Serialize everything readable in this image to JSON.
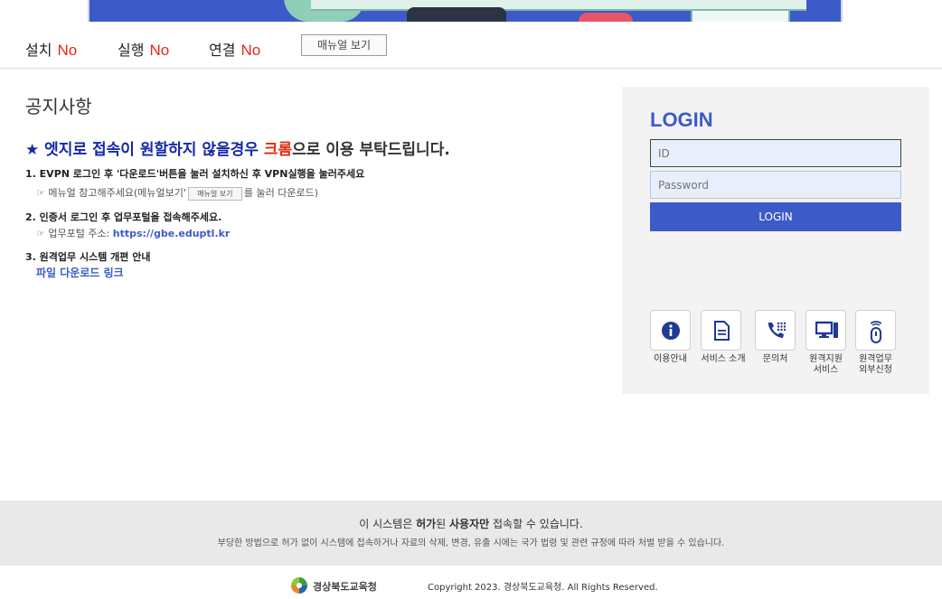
{
  "status": {
    "items": [
      {
        "label": "설치",
        "value": "No"
      },
      {
        "label": "실행",
        "value": "No"
      },
      {
        "label": "연결",
        "value": "No"
      }
    ],
    "manual_button": "매뉴얼 보기"
  },
  "notice": {
    "title": "공지사항",
    "headline": {
      "star": "★",
      "part1": "엣지로 접속이 원할하지 않을경우",
      "part2": "크롬",
      "part3": "으로 이용 부탁드립니다."
    },
    "step1": "1. EVPN 로그인 후 '다운로드'버튼을 눌러 설치하신 후 VPN실행을 눌러주세요",
    "step1_sub_prefix": "☞ 메뉴얼 참고해주세요(메뉴얼보기'",
    "step1_sub_button": "매뉴얼 보기",
    "step1_sub_suffix": "를 눌러 다운로드)",
    "step2": "2. 인증서 로그인 후 업무포털을 접속해주세요.",
    "step2_sub_prefix": "☞ 업무포털 주소: ",
    "step2_sub_link": "https://gbe.eduptl.kr",
    "step3": "3. 원격업무 시스템 개편 안내",
    "file_link": "파일 다운로드 링크"
  },
  "login": {
    "title": "LOGIN",
    "id_placeholder": "ID",
    "pw_placeholder": "Password",
    "button": "LOGIN"
  },
  "quick": [
    {
      "icon": "info-icon",
      "label": "이용안내"
    },
    {
      "icon": "document-icon",
      "label": "서비스 소개"
    },
    {
      "icon": "phone-icon",
      "label": "문의처"
    },
    {
      "icon": "computer-icon",
      "label": "원격지원\n서비스"
    },
    {
      "icon": "remote-icon",
      "label": "원격업무\n외부신청"
    }
  ],
  "footer": {
    "line1_a": "이 시스템은 ",
    "line1_b": "허가",
    "line1_c": "된 ",
    "line1_d": "사용자만",
    "line1_e": " 접속할 수 있습니다.",
    "line2": "부당한 방법으로 허가 없이 시스템에 접속하거나 자료의 삭제, 변경, 유출 시에는 국가 법령 및 관련 규정에 따라 처벌 받을 수 있습니다.",
    "logo_text": "경상북도교육청",
    "copyright": "Copyright 2023. 경상북도교육청. All Rights Reserved."
  },
  "colors": {
    "accent": "#3d5bc8",
    "status_no": "#e02a12",
    "headline_blue": "#1428a8"
  }
}
